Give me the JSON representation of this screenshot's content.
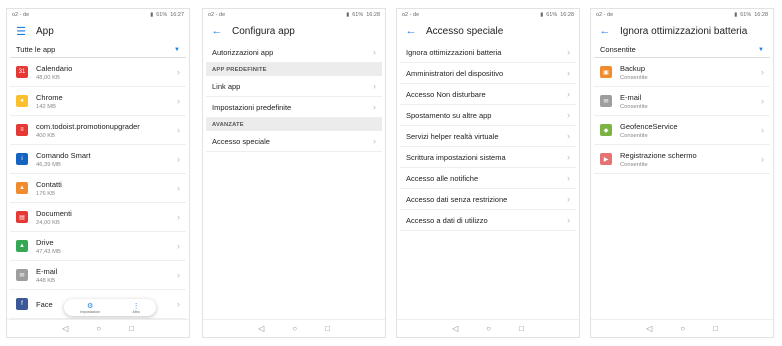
{
  "status": {
    "carrier": "o2 - de",
    "battery": "61%",
    "time1": "16:27",
    "time2": "16:28",
    "time3": "16:28",
    "time4": "16:28"
  },
  "screen1": {
    "title": "App",
    "filter": "Tutte le app",
    "apps": [
      {
        "name": "Calendario",
        "sub": "48,00 KB",
        "color": "#e53935",
        "glyph": "31"
      },
      {
        "name": "Chrome",
        "sub": "142 MB",
        "color": "#fbc02d",
        "glyph": "●"
      },
      {
        "name": "com.todoist.promotionupgrader",
        "sub": "400 KB",
        "color": "#e53935",
        "glyph": "≡"
      },
      {
        "name": "Comando Smart",
        "sub": "46,39 MB",
        "color": "#1565c0",
        "glyph": "i"
      },
      {
        "name": "Contatti",
        "sub": "176 KB",
        "color": "#f08c2e",
        "glyph": "▲"
      },
      {
        "name": "Documenti",
        "sub": "24,00 KB",
        "color": "#e53935",
        "glyph": "▤"
      },
      {
        "name": "Drive",
        "sub": "47,43 MB",
        "color": "#34a853",
        "glyph": "▲"
      },
      {
        "name": "E-mail",
        "sub": "448 KB",
        "color": "#9e9e9e",
        "glyph": "✉"
      },
      {
        "name": "Face",
        "sub": "",
        "color": "#3b5998",
        "glyph": "f"
      }
    ],
    "fab": {
      "settings_label": "Impostazioni",
      "more_label": "Altro"
    }
  },
  "screen2": {
    "title": "Configura app",
    "items": [
      {
        "type": "row",
        "label": "Autorizzazioni app"
      },
      {
        "type": "section",
        "label": "APP PREDEFINITE"
      },
      {
        "type": "row",
        "label": "Link app"
      },
      {
        "type": "row",
        "label": "Impostazioni predefinite"
      },
      {
        "type": "section",
        "label": "AVANZATE"
      },
      {
        "type": "row",
        "label": "Accesso speciale"
      }
    ]
  },
  "screen3": {
    "title": "Accesso speciale",
    "items": [
      "Ignora ottimizzazioni batteria",
      "Amministratori del dispositivo",
      "Accesso Non disturbare",
      "Spostamento su altre app",
      "Servizi helper realtà virtuale",
      "Scrittura impostazioni sistema",
      "Accesso alle notifiche",
      "Accesso dati senza restrizione",
      "Accesso a dati di utilizzo"
    ]
  },
  "screen4": {
    "title": "Ignora ottimizzazioni batteria",
    "filter": "Consentite",
    "apps": [
      {
        "name": "Backup",
        "sub": "Consentite",
        "color": "#f08c2e",
        "glyph": "▣"
      },
      {
        "name": "E-mail",
        "sub": "Consentite",
        "color": "#9e9e9e",
        "glyph": "✉"
      },
      {
        "name": "GeofenceService",
        "sub": "Consentite",
        "color": "#7cb342",
        "glyph": "◆"
      },
      {
        "name": "Registrazione schermo",
        "sub": "Consentite",
        "color": "#e57373",
        "glyph": "▶"
      }
    ]
  },
  "nav": {
    "back": "◁",
    "home": "○",
    "recents": "□"
  }
}
